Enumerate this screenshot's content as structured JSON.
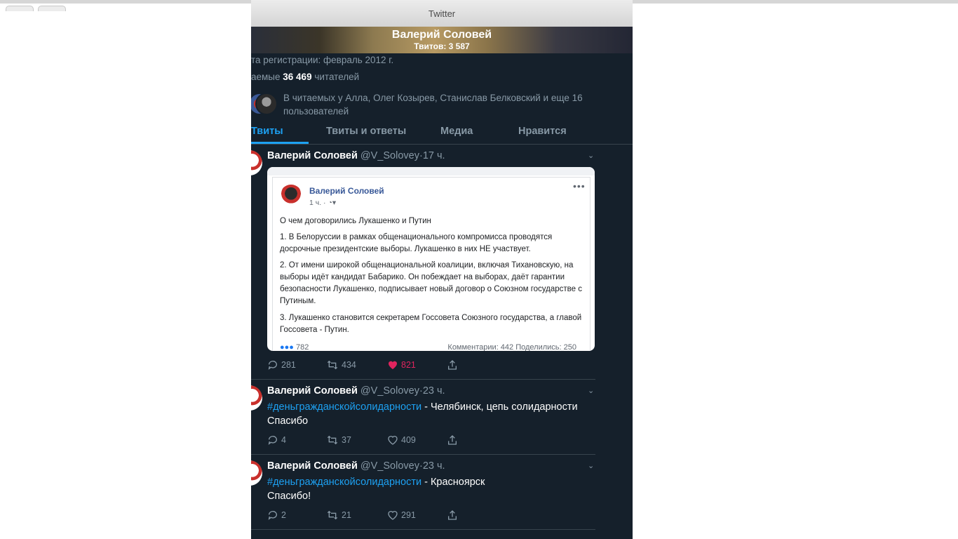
{
  "window": {
    "title": "Twitter"
  },
  "profile": {
    "name": "Валерий Соловей",
    "tweets_count": "Твитов: 3 587",
    "joined": "та регистрации: февраль 2012 г.",
    "followers_prefix": "аемые",
    "followers_count": "36 469",
    "followers_suffix": "читателей",
    "followed_by": "В читаемых у Алла, Олег Козырев, Станислав Белковский и еще 16 пользователей"
  },
  "tabs": [
    {
      "label": "Твиты",
      "active": true
    },
    {
      "label": "Твиты и ответы",
      "active": false
    },
    {
      "label": "Медиа",
      "active": false
    },
    {
      "label": "Нравится",
      "active": false
    }
  ],
  "tweets": [
    {
      "name": "Валерий Соловей",
      "handle": "@V_Solovey",
      "time": "17 ч.",
      "card": {
        "author": "Валерий Соловей",
        "time": "1 ч. ·",
        "paragraphs": [
          "О чем договорились Лукашенко и Путин",
          "1. В Белоруссии в рамках общенационального компромисса проводятся досрочные президентские выборы. Лукашенко в них НЕ участвует.",
          "2. От имени широкой общенациональной коалиции, включая Тихановскую, на выборы идёт кандидат Бабарико. Он побеждает на выборах, даёт гарантии безопасности Лукашенко, подписывает новый договор о Союзном государстве с Путиным.",
          "3. Лукашенко становится секретарем Госсовета Союзного государства, а главой Госсовета - Путин."
        ],
        "reactions": "782",
        "stats": "Комментарии: 442  Поделились: 250"
      },
      "replies": "281",
      "retweets": "434",
      "likes": "821"
    },
    {
      "name": "Валерий Соловей",
      "handle": "@V_Solovey",
      "time": "23 ч.",
      "hashtag": "#деньгражданскойсолидарности",
      "text": " - Челябинск, цепь солидарности",
      "line2": "Спасибо",
      "replies": "4",
      "retweets": "37",
      "likes": "409"
    },
    {
      "name": "Валерий Соловей",
      "handle": "@V_Solovey",
      "time": "23 ч.",
      "hashtag": "#деньгражданскойсолидарности",
      "text": " - Красноярск",
      "line2": "Спасибо!",
      "replies": "2",
      "retweets": "21",
      "likes": "291"
    }
  ],
  "colors": {
    "accent": "#1da1f2",
    "background": "#15202b",
    "like": "#e0245e",
    "muted": "#8899a6"
  }
}
